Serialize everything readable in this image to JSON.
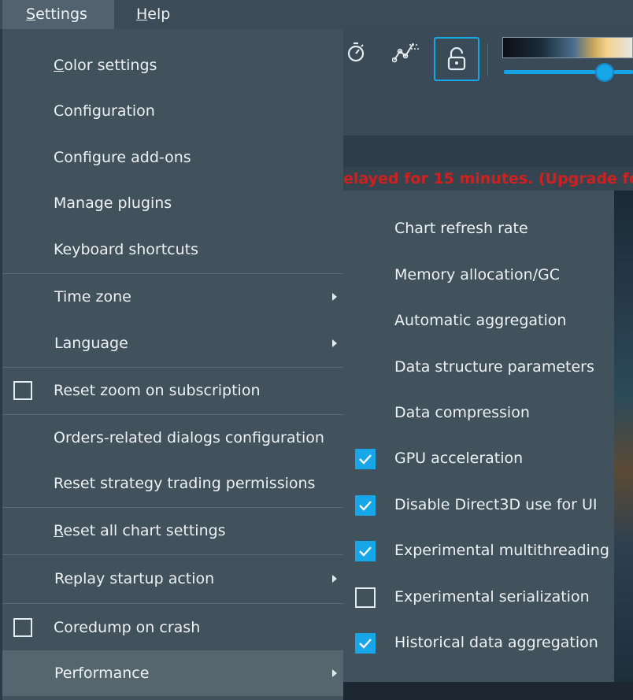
{
  "menubar": {
    "settings": "Settings",
    "help": "Help"
  },
  "toolbar": {
    "icons": [
      "stopwatch-icon",
      "chart-line-icon",
      "unlock-icon"
    ]
  },
  "notice": {
    "text": "elayed for 15 minutes. (Upgrade for"
  },
  "settings_menu": {
    "items": [
      {
        "label": "Color settings",
        "mnemonic": "C"
      },
      {
        "label": "Configuration"
      },
      {
        "label": "Configure add-ons"
      },
      {
        "label": "Manage plugins"
      },
      {
        "label": "Keyboard shortcuts"
      },
      {
        "label": "Time zone",
        "submenu": true
      },
      {
        "label": "Language",
        "submenu": true
      },
      {
        "label": "Reset zoom on subscription",
        "checkbox": true,
        "checked": false
      },
      {
        "label": "Orders-related dialogs configuration"
      },
      {
        "label": "Reset strategy trading permissions"
      },
      {
        "label": "Reset all chart settings",
        "mnemonic": "R"
      },
      {
        "label": "Replay startup action",
        "submenu": true
      },
      {
        "label": "Coredump on crash",
        "checkbox": true,
        "checked": false
      },
      {
        "label": "Performance",
        "submenu": true,
        "highlighted": true
      }
    ]
  },
  "performance_menu": {
    "items": [
      {
        "label": "Chart refresh rate"
      },
      {
        "label": "Memory allocation/GC"
      },
      {
        "label": "Automatic aggregation"
      },
      {
        "label": "Data structure parameters"
      },
      {
        "label": "Data compression"
      },
      {
        "label": "GPU acceleration",
        "checkbox": true,
        "checked": true
      },
      {
        "label": "Disable Direct3D use for UI",
        "checkbox": true,
        "checked": true
      },
      {
        "label": "Experimental multithreading",
        "checkbox": true,
        "checked": true
      },
      {
        "label": "Experimental serialization",
        "checkbox": true,
        "checked": false
      },
      {
        "label": "Historical data aggregation",
        "checkbox": true,
        "checked": true
      }
    ]
  },
  "colors": {
    "accent": "#17a6e8",
    "menu_bg": "#42525d",
    "highlight": "#56666f",
    "warning": "#d21f1f"
  }
}
